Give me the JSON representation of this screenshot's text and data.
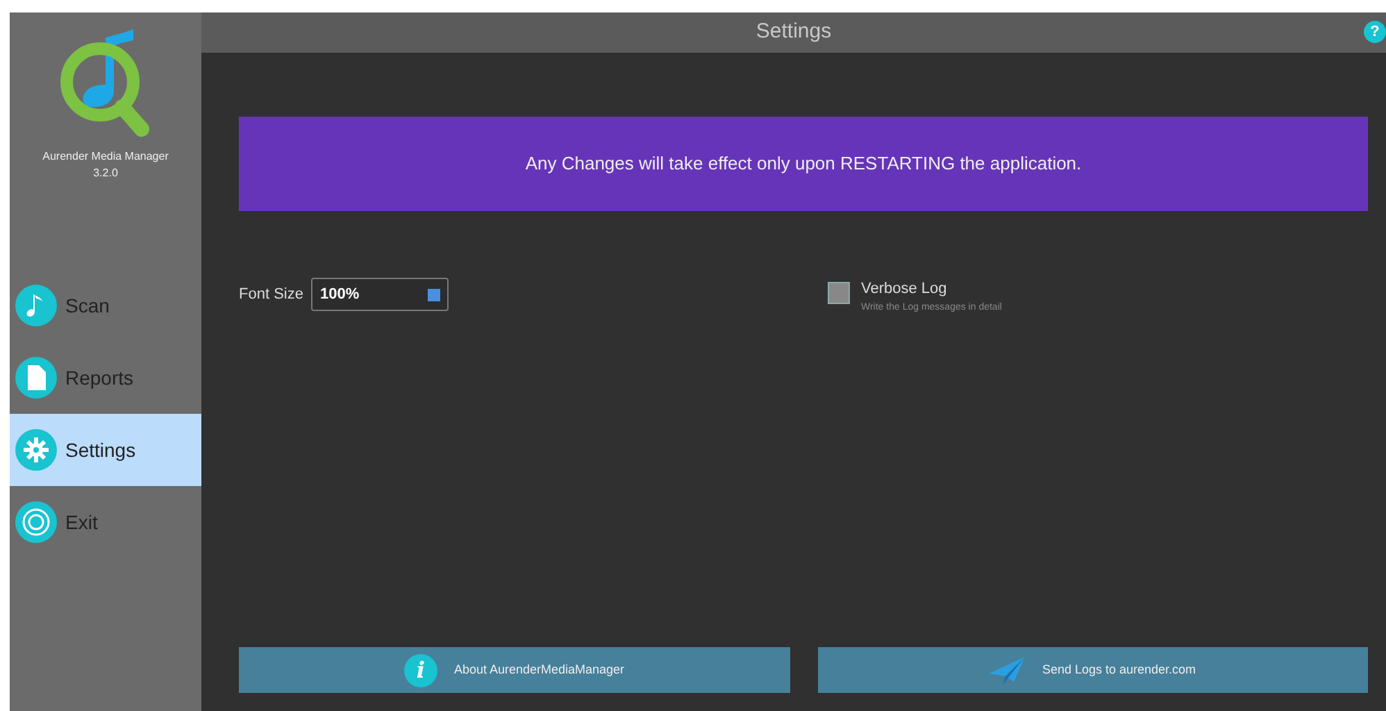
{
  "app": {
    "name": "Aurender Media Manager",
    "version": "3.2.0"
  },
  "sidebar": {
    "items": [
      {
        "label": "Scan",
        "kind": "scan",
        "selected": false
      },
      {
        "label": "Reports",
        "kind": "reports",
        "selected": false
      },
      {
        "label": "Settings",
        "kind": "settings",
        "selected": true
      },
      {
        "label": "Exit",
        "kind": "exit",
        "selected": false
      }
    ]
  },
  "title_bar": {
    "title": "Settings",
    "help": "?"
  },
  "notice": "Any Changes will take effect only upon RESTARTING the application.",
  "font_size": {
    "label": "Font Size",
    "value": "100%"
  },
  "verbose_log": {
    "label": "Verbose Log",
    "description": "Write the Log messages in detail",
    "checked": false
  },
  "buttons": [
    {
      "label": "About AurenderMediaManager",
      "kind": "about",
      "glyph": "i"
    },
    {
      "label": "Send Logs to aurender.com",
      "kind": "send"
    }
  ]
}
